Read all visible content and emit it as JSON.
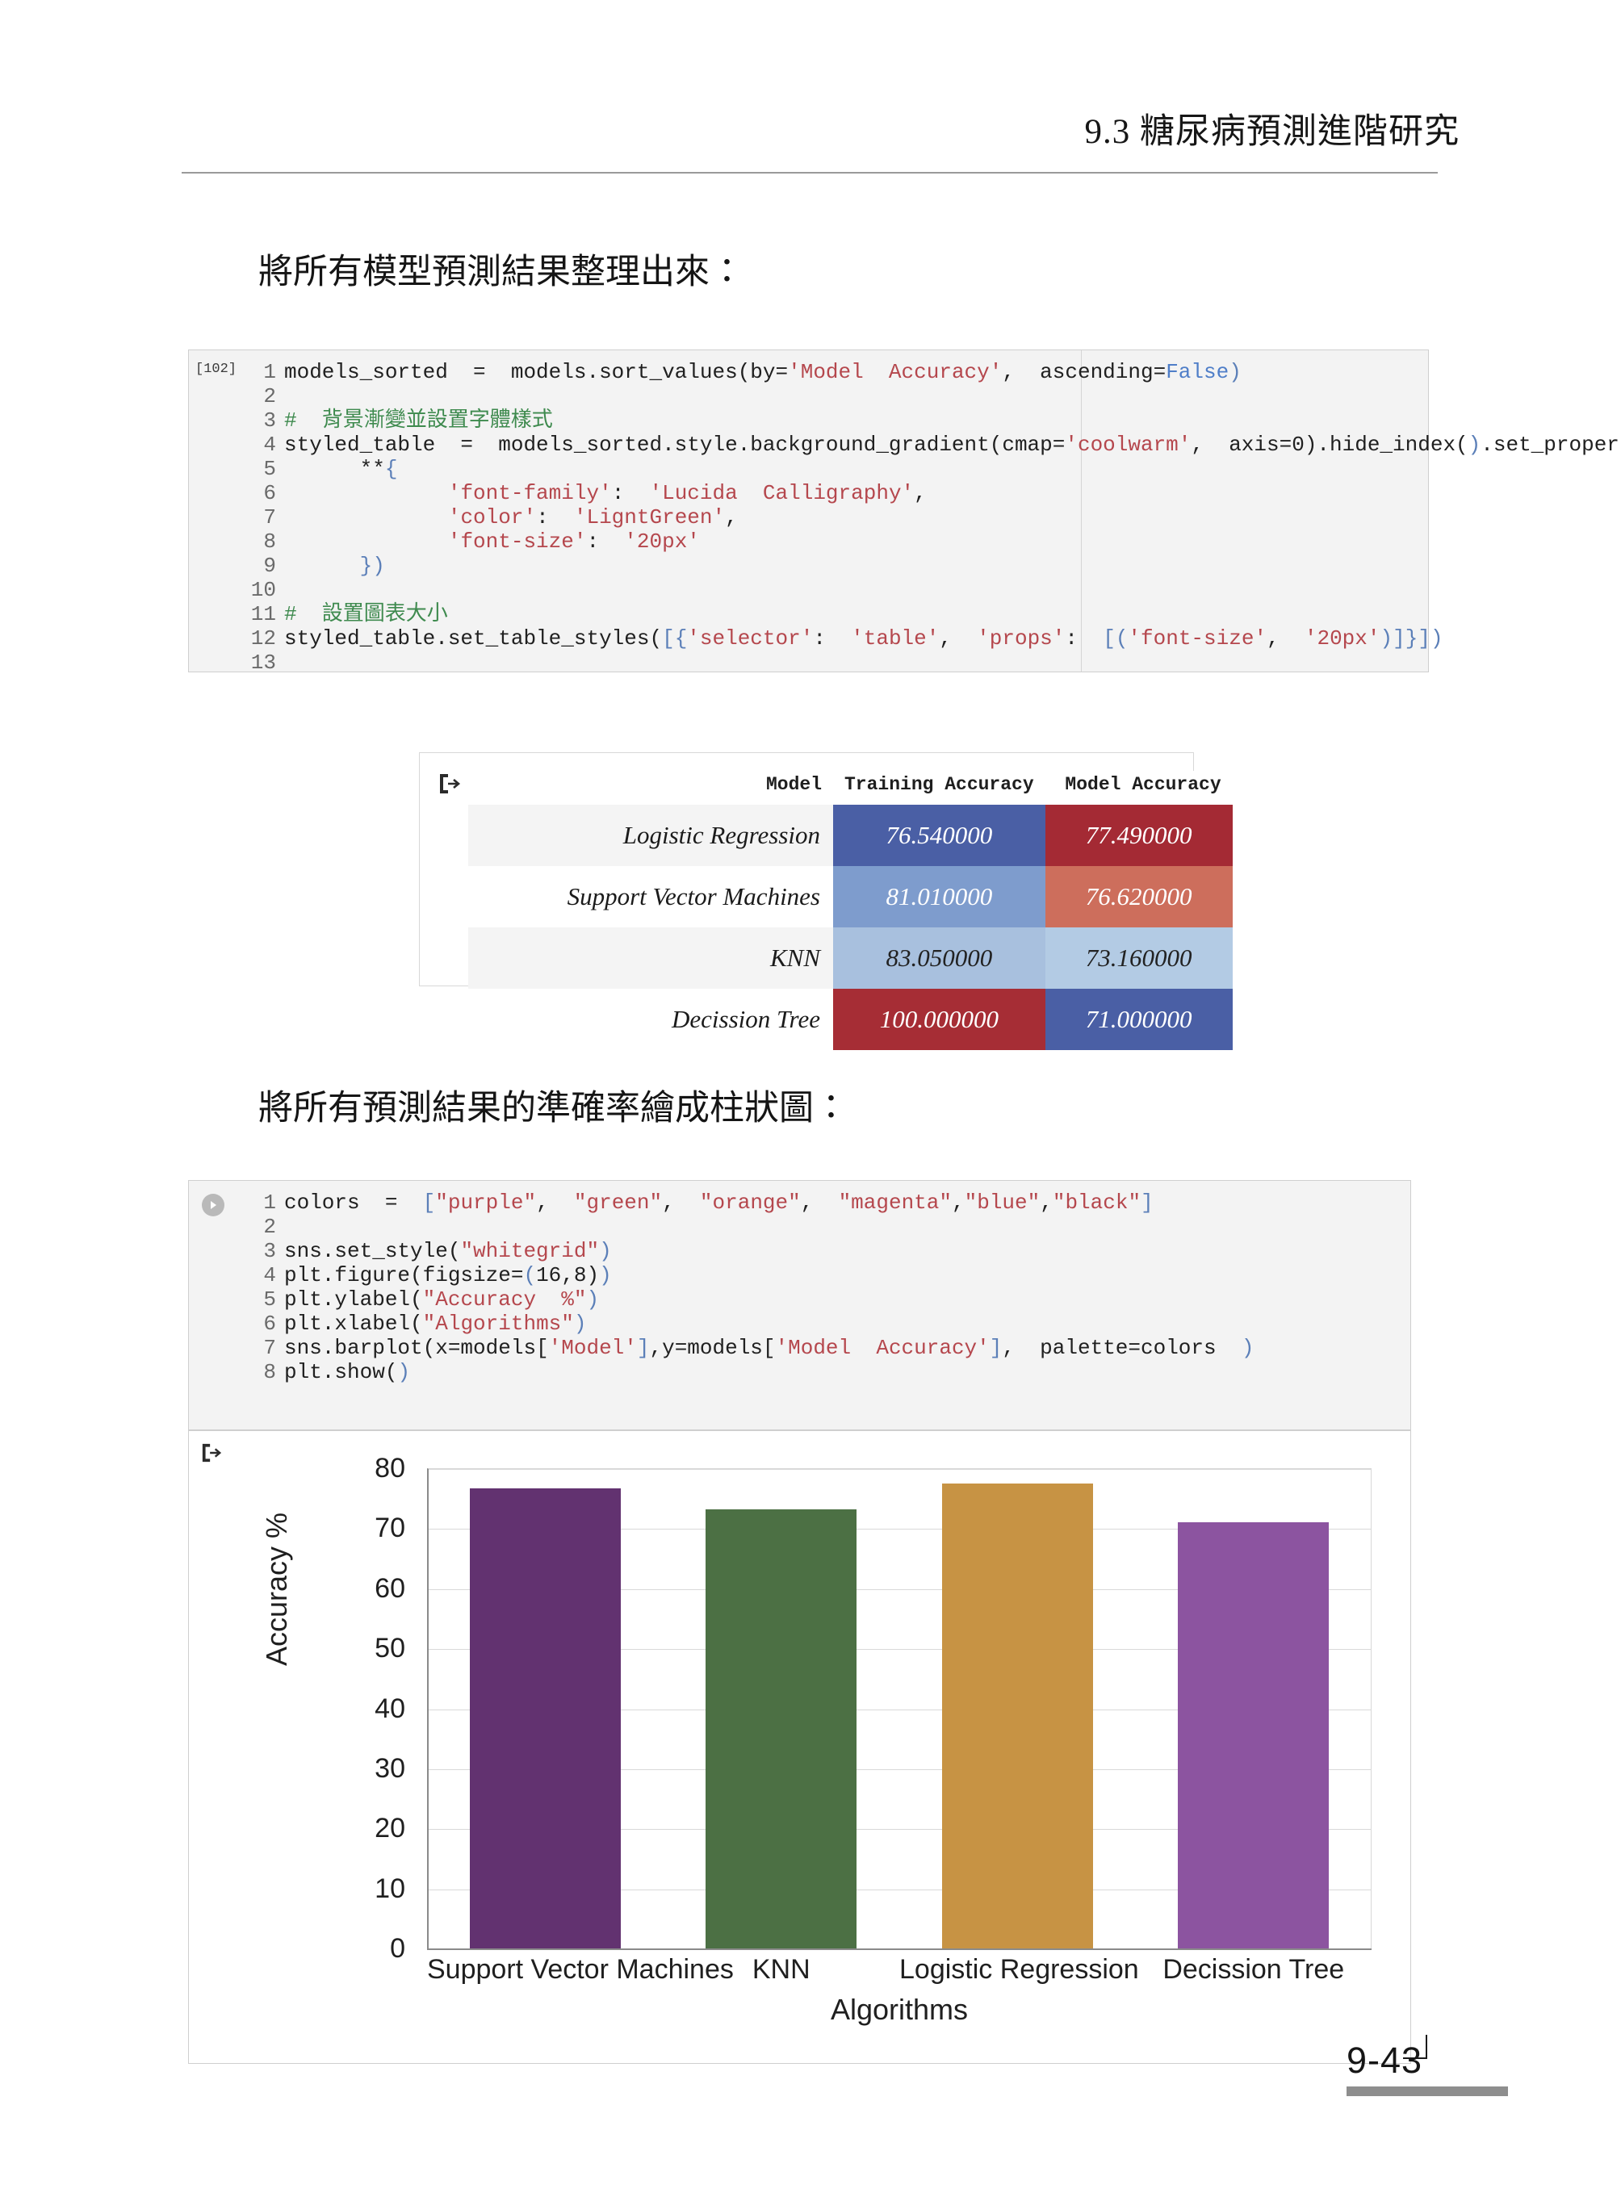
{
  "header": {
    "section_number": "9.3",
    "title": "9.3  糖尿病預測進階研究"
  },
  "captions": {
    "first": "將所有模型預測結果整理出來：",
    "second": "將所有預測結果的準確率繪成柱狀圖："
  },
  "code_cell_1": {
    "prompt": "[102]",
    "lines": [
      {
        "n": "1",
        "text": "models_sorted  =  models.sort_values(by='Model  Accuracy',  ascending=False)"
      },
      {
        "n": "2",
        "text": ""
      },
      {
        "n": "3",
        "text": "#  背景漸變並設置字體樣式"
      },
      {
        "n": "4",
        "text": "styled_table  =  models_sorted.style.background_gradient(cmap='coolwarm',  axis=0).hide_index().set_properties("
      },
      {
        "n": "5",
        "text": "      **{"
      },
      {
        "n": "6",
        "text": "             'font-family':  'Lucida  Calligraphy',"
      },
      {
        "n": "7",
        "text": "             'color':  'LigntGreen',"
      },
      {
        "n": "8",
        "text": "             'font-size':  '20px'"
      },
      {
        "n": "9",
        "text": "      })"
      },
      {
        "n": "10",
        "text": ""
      },
      {
        "n": "11",
        "text": "#  設置圖表大小"
      },
      {
        "n": "12",
        "text": "styled_table.set_table_styles([{'selector':  'table',  'props':  [('font-size',  '20px')]}])"
      },
      {
        "n": "13",
        "text": ""
      }
    ]
  },
  "code_cell_2": {
    "run_icon": "run-cell-icon",
    "lines": [
      {
        "n": "1",
        "text": "colors  =  [\"purple\",  \"green\",  \"orange\",  \"magenta\",\"blue\",\"black\"]"
      },
      {
        "n": "2",
        "text": ""
      },
      {
        "n": "3",
        "text": "sns.set_style(\"whitegrid\")"
      },
      {
        "n": "4",
        "text": "plt.figure(figsize=(16,8))"
      },
      {
        "n": "5",
        "text": "plt.ylabel(\"Accuracy  %\")"
      },
      {
        "n": "6",
        "text": "plt.xlabel(\"Algorithms\")"
      },
      {
        "n": "7",
        "text": "sns.barplot(x=models['Model'],y=models['Model  Accuracy'],  palette=colors  )"
      },
      {
        "n": "8",
        "text": "plt.show()"
      }
    ]
  },
  "table_output": {
    "icon": "output-arrow-icon",
    "columns": [
      "Model",
      "Training Accuracy",
      "Model Accuracy"
    ],
    "rows": [
      {
        "model": "Logistic Regression",
        "training_accuracy": "76.540000",
        "model_accuracy": "77.490000",
        "training_bg": "#4a5fa5",
        "model_bg": "#a42a34",
        "training_fg": "#ffffff",
        "model_fg": "#ffffff"
      },
      {
        "model": "Support Vector Machines",
        "training_accuracy": "81.010000",
        "model_accuracy": "76.620000",
        "training_bg": "#7e9ccd",
        "model_bg": "#cd6e5c",
        "training_fg": "#ffffff",
        "model_fg": "#ffffff"
      },
      {
        "model": "KNN",
        "training_accuracy": "83.050000",
        "model_accuracy": "73.160000",
        "training_bg": "#a8c0de",
        "model_bg": "#b3cbe4",
        "training_fg": "#222222",
        "model_fg": "#222222"
      },
      {
        "model": "Decission Tree",
        "training_accuracy": "100.000000",
        "model_accuracy": "71.000000",
        "training_bg": "#a62d35",
        "model_bg": "#4a5fa5",
        "training_fg": "#ffffff",
        "model_fg": "#ffffff"
      }
    ]
  },
  "chart_data": {
    "type": "bar",
    "title": "",
    "xlabel": "Algorithms",
    "ylabel": "Accuracy %",
    "categories": [
      "Support Vector Machines",
      "KNN",
      "Logistic Regression",
      "Decission Tree"
    ],
    "values": [
      76.62,
      73.16,
      77.49,
      71.0
    ],
    "colors": [
      "#623270",
      "#4c7044",
      "#c79344",
      "#8c54a0"
    ],
    "ylim": [
      0,
      80
    ],
    "yticks": [
      0,
      10,
      20,
      30,
      40,
      50,
      60,
      70,
      80
    ],
    "ytick_labels": [
      "0",
      "10",
      "20",
      "30",
      "40",
      "50",
      "60",
      "70",
      "80"
    ],
    "grid": true,
    "legend": "none"
  },
  "footer": {
    "page_number": "9-43"
  }
}
